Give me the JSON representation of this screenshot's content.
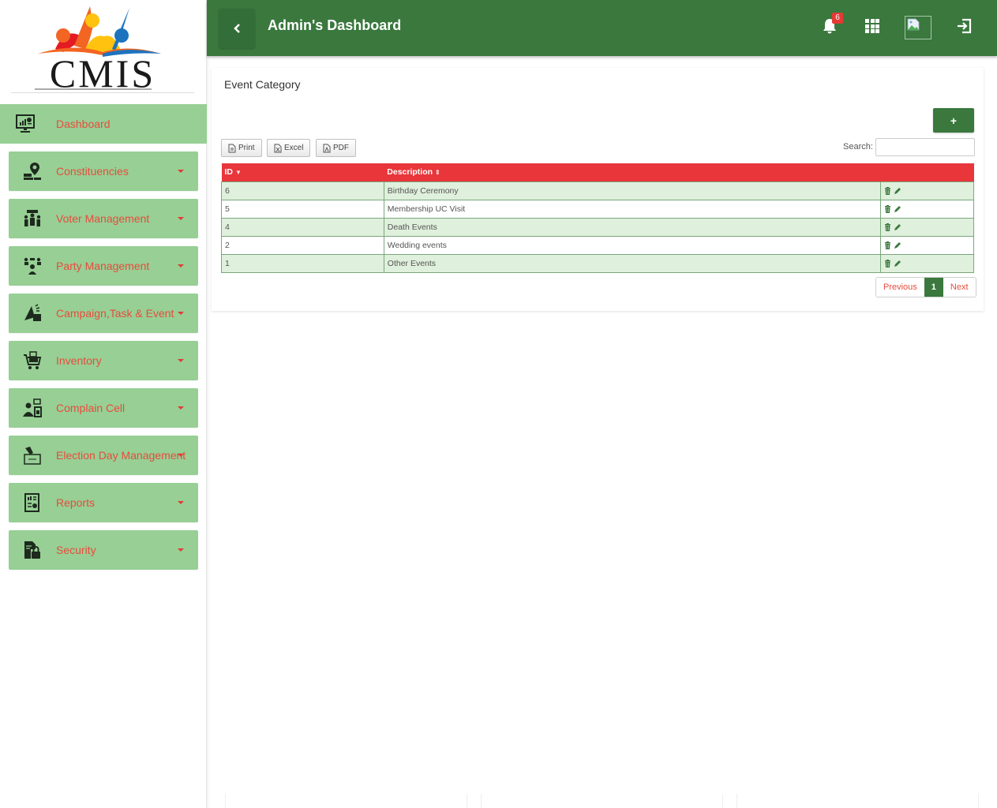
{
  "brand": {
    "name": "CMIS",
    "logo_colors": [
      "#f26522",
      "#ffc20e",
      "#1e73be",
      "#e31b23"
    ]
  },
  "sidebar": {
    "items": [
      {
        "label": "Dashboard",
        "icon": "monitor-chart-icon",
        "has_caret": false,
        "active": true
      },
      {
        "label": "Constituencies",
        "icon": "map-pin-icon",
        "has_caret": true
      },
      {
        "label": "Voter Management",
        "icon": "voters-icon",
        "has_caret": true
      },
      {
        "label": "Party Management",
        "icon": "party-people-icon",
        "has_caret": true
      },
      {
        "label": "Campaign,Task & Event",
        "icon": "megaphone-icon",
        "has_caret": true
      },
      {
        "label": "Inventory",
        "icon": "cart-icon",
        "has_caret": true
      },
      {
        "label": "Complain Cell",
        "icon": "complaint-icon",
        "has_caret": true
      },
      {
        "label": "Election Day Management",
        "icon": "ballot-box-icon",
        "has_caret": true
      },
      {
        "label": "Reports",
        "icon": "report-icon",
        "has_caret": true
      },
      {
        "label": "Security",
        "icon": "security-lock-icon",
        "has_caret": true
      }
    ]
  },
  "header": {
    "title": "Admin's Dashboard",
    "notification_count": "6",
    "back_icon": "chevron-left-icon",
    "apps_icon": "grid-icon",
    "avatar_icon": "broken-image-icon",
    "logout_icon": "sign-out-icon"
  },
  "content": {
    "title": "Event Category",
    "add_label": "+",
    "export_buttons": [
      "Print",
      "Excel",
      "PDF"
    ],
    "search": {
      "label": "Search:",
      "value": "",
      "placeholder": ""
    },
    "table": {
      "columns": [
        "ID",
        "Description",
        ""
      ],
      "sort": {
        "column": "ID",
        "direction": "desc"
      },
      "rows": [
        {
          "id": "6",
          "description": "Birthday Ceremony"
        },
        {
          "id": "5",
          "description": "Membership UC Visit"
        },
        {
          "id": "4",
          "description": "Death Events"
        },
        {
          "id": "2",
          "description": "Wedding events"
        },
        {
          "id": "1",
          "description": "Other Events"
        }
      ]
    },
    "pagination": {
      "previous": "Previous",
      "current": "1",
      "next": "Next"
    }
  },
  "colors": {
    "header_green": "#3a783e",
    "sidebar_item": "#97cf95",
    "nav_text": "#e74c3c",
    "table_header": "#e8363b",
    "row_stripe": "#dff0dc"
  }
}
